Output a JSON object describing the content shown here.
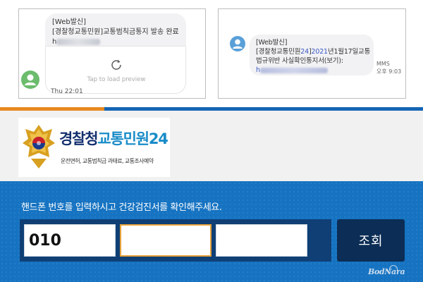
{
  "sms_left": {
    "message_line1": "[Web발신]",
    "message_line2": "[경찰청교통민원]교통범칙금통지 발송 완료 h",
    "preview_label": "Tap to load preview",
    "time": "Thu 22:01",
    "icons": {
      "reload": "reload-icon",
      "avatar": "person-avatar-icon"
    },
    "colors": {
      "avatar": "#6cbc6e"
    }
  },
  "sms_right": {
    "line1": "[Web발신]",
    "line2_a": "[경찰청교통민원",
    "line2_link": "24",
    "line2_b": "]",
    "line2_date": "2021",
    "line2_c": "년1월17일교통",
    "line3": "법규위반 사실확인통지서(보기):",
    "meta_type": "MMS",
    "meta_time": "오후 9:03",
    "icons": {
      "avatar": "person-avatar-icon"
    },
    "colors": {
      "avatar": "#5aa0d8",
      "link": "#3a58c6"
    }
  },
  "site": {
    "logo_title_a": "경찰청",
    "logo_title_b": "교통민원",
    "logo_title_c": "24",
    "logo_subtitle": "운전면허, 교통범칙금 과태료, 교통조사예약",
    "icons": {
      "emblem": "police-emblem-icon"
    },
    "colors": {
      "accent": "#e8891f",
      "brand_blue": "#1565b4",
      "form_bg": "#1673c2"
    }
  },
  "form": {
    "instruction": "핸드폰 번호를 입력하시고 건강검진서를 확인해주세요.",
    "phone_part1": "010",
    "phone_part2": "",
    "phone_part3": "",
    "submit_label": "조회"
  },
  "watermark": "BodNara"
}
